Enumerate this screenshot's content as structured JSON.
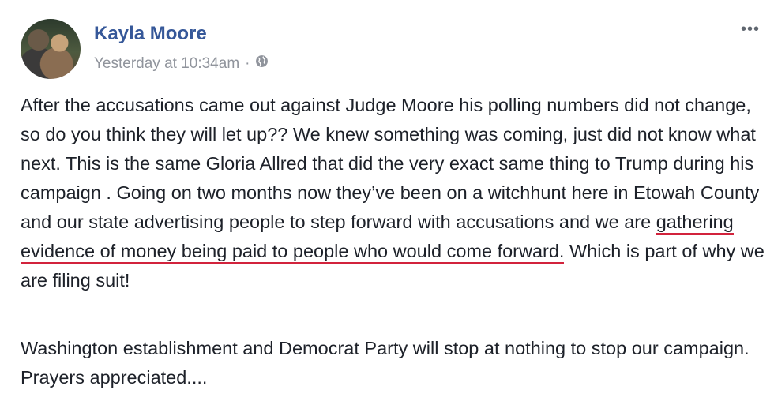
{
  "post": {
    "author": "Kayla Moore",
    "timestamp": "Yesterday at 10:34am",
    "separator": "·",
    "privacy_icon": "globe-icon",
    "more_label": "•••",
    "paragraph1": {
      "before": "After the accusations came out against Judge Moore his polling numbers did not change, so do you think they will let up?? We knew something was coming, just did not know what next. This is the same Gloria Allred that did the very exact same thing to Trump during his campaign . Going on two months now they’ve been on a witchhunt here in Etowah County and our state advertising people to step forward with accusations and we are ",
      "underlined": "gathering evidence of money being paid to people who would come forward.",
      "after": " Which is part of why we are filing suit!"
    },
    "paragraph2": "Washington establishment and Democrat Party will stop at nothing to stop our campaign. Prayers appreciated....",
    "colors": {
      "author": "#365899",
      "meta": "#90949c",
      "text": "#1d2129",
      "underline": "#d2233c"
    }
  }
}
